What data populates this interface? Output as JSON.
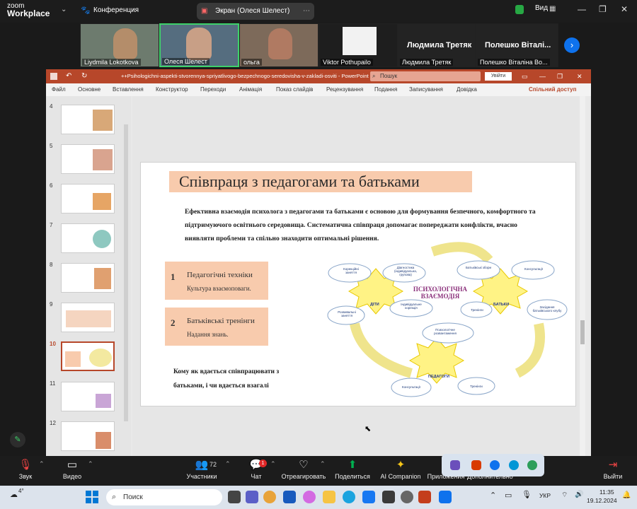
{
  "zoom": {
    "logo_line1": "zoom",
    "logo_line2": "Workplace",
    "meeting_label": "Конференция",
    "share_label": "Экран (Олеся Шелест)",
    "view_label": "Вид",
    "participants": [
      {
        "name": "Liydmila Lokotkova"
      },
      {
        "name": "Олеся Шелест"
      },
      {
        "name": "ольга"
      },
      {
        "name": "Viktor Pothupailo"
      },
      {
        "name": "Людмила Третяк",
        "top_name": "Людмила Третяк"
      },
      {
        "name": "Полешко Віталіна Во...",
        "top_name": "Полешко  Віталі..."
      }
    ]
  },
  "powerpoint": {
    "title": "++Psihologichni-aspekti-stvorennya-spriyatlivogo-bezpechnogo-seredovisha-v-zakladi-osviti  -  PowerPoint",
    "search_placeholder": "Пошук",
    "signin_label": "Увійти",
    "share_label": "Спільний доступ",
    "menu": [
      "Файл",
      "Основне",
      "Вставлення",
      "Конструктор",
      "Переходи",
      "Анімація",
      "Показ слайдів",
      "Рецензування",
      "Подання",
      "Записування",
      "Довідка"
    ],
    "slide_numbers": [
      "4",
      "5",
      "6",
      "7",
      "8",
      "9",
      "10",
      "11",
      "12"
    ],
    "current_slide": "10",
    "slide": {
      "title": "Співпраця з педагогами та батьками",
      "body": "Ефективна взаємодія психолога з педагогами та батьками є основою для формування безпечного, комфортного та підтримуючого освітнього середовища. Систематична співпраця допомагає попереджати конфлікти, вчасно виявляти проблеми та спільно знаходити оптимальні рішення.",
      "boxes": [
        {
          "num": "1",
          "title": "Педагогічні техніки",
          "subtitle": "Культура взаємоповаги."
        },
        {
          "num": "2",
          "title": "Батьківські тренінги",
          "subtitle": "Надання знань."
        }
      ],
      "question": "Кому як вдається співпрацювати з батьками, і чи вдається взагалі",
      "diagram": {
        "center": "ПСИХОЛОГІЧНА ВЗАЄМОДІЯ",
        "hubs": [
          "ДІТИ",
          "БАТЬКИ",
          "ПЕДАГОГИ"
        ],
        "children_items": [
          "Корекційні заняття",
          "Діагностика (індивідуальна, групова)",
          "Розвивальні заняття",
          "Індивідуальне корекція"
        ],
        "parents_items": [
          "Батьківські збори",
          "Консультації",
          "Тренінги",
          "Засідання батьківського клубу"
        ],
        "teachers_items": [
          "Психологічне розвантаження",
          "Консультації",
          "Тренінги"
        ]
      }
    }
  },
  "toolbar": {
    "sound": "Звук",
    "video": "Видео",
    "participants_label": "Участники",
    "participants_count": "72",
    "chat": "Чат",
    "chat_badge": "1",
    "react": "Отреагировать",
    "share": "Поделиться",
    "ai": "AI Companion",
    "apps": "Приложения",
    "more": "Дополнительно",
    "leave": "Выйти"
  },
  "taskbar": {
    "weather": "4°",
    "search_placeholder": "Поиск",
    "lang": "УКР",
    "time": "11:35",
    "date": "19.12.2024"
  },
  "colors": {
    "ppt_red": "#b7472a",
    "zoom_blue": "#0e72ed",
    "slide_peach": "#f8cbad",
    "share_green": "#00b050"
  }
}
